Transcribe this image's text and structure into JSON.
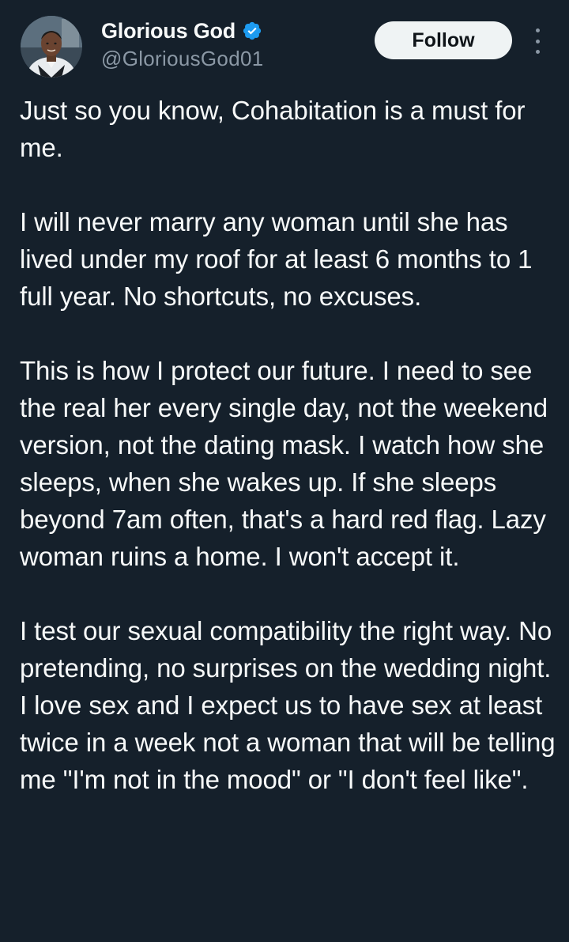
{
  "author": {
    "display_name": "Glorious God",
    "handle": "@GloriousGod01",
    "verified": true,
    "avatar": "avatar-photo"
  },
  "actions": {
    "follow_label": "Follow",
    "more_icon": "more-vertical-icon"
  },
  "tweet": {
    "paragraphs": [
      "Just so you know, Cohabitation is a must for me.",
      "I will never marry any woman until she has lived under my roof for at least 6 months to 1 full year. No shortcuts, no excuses.",
      "This is how I protect our future. I need to see the real her every single day, not the weekend version, not the dating mask. I watch how she sleeps, when she wakes up. If she sleeps beyond 7am often, that's a hard red flag. Lazy woman ruins a home. I won't accept it.",
      "I test our sexual compatibility the right way. No pretending, no surprises on the wedding night. I love sex and I expect us to have sex at least twice in a week not a woman that will be telling me \"I'm not in the mood\" or \"I don't feel like\"."
    ]
  },
  "colors": {
    "background": "#15202b",
    "text": "#f7f9f9",
    "secondary_text": "#8b98a5",
    "verified_badge": "#1d9bf0",
    "follow_button_bg": "#eff3f4",
    "follow_button_text": "#0f1419"
  }
}
